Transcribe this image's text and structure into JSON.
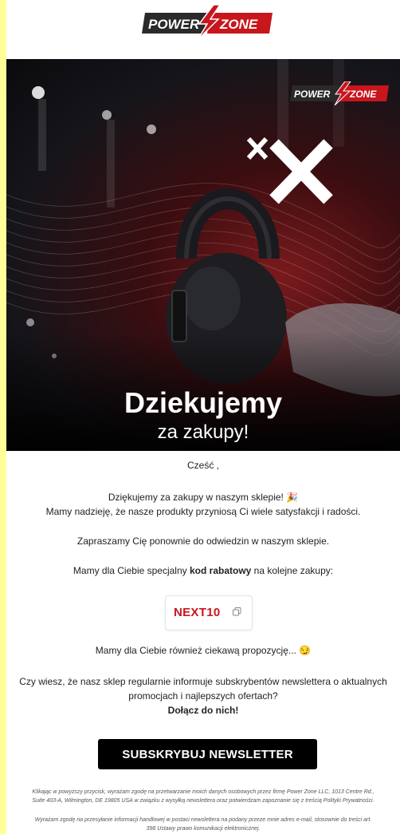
{
  "brand": {
    "part1": "POWER",
    "part2": "ZONE"
  },
  "hero": {
    "title": "Dziekujemy",
    "subtitle": "za zakupy!"
  },
  "greeting": "Cześć ,",
  "thanks_line1": "Dziękujemy za zakupy w naszym sklepie! 🎉",
  "thanks_line2": "Mamy nadzieję, że nasze produkty przyniosą Ci wiele satysfakcji i radości.",
  "invite": "Zapraszamy Cię ponownie do odwiedzin w naszym sklepie.",
  "discount": {
    "before": "Mamy dla Ciebie specjalny ",
    "bold": "kod rabatowy",
    "after": " na kolejne zakupy:"
  },
  "code": "NEXT10",
  "proposal": "Mamy dla Ciebie również ciekawą propozycję... 😏",
  "newsletter_line1": "Czy wiesz, że nasz sklep regularnie informuje subskrybentów newslettera o aktualnych",
  "newsletter_line2": "promocjach i najlepszych ofertach?",
  "join": "Dołącz do nich!",
  "button_label": "SUBSKRYBUJ NEWSLETTER",
  "consent1_line1": "Klikając w powyższy przycisk, wyrażam zgodę na przetwarzanie moich danych osobowych przez firmę Power Zone LLC, 1013 Centre Rd.,",
  "consent1_line2": "Suite 403-A, Wilmington, DE 19805 USA w związku z wysyłką newslettera oraz potwierdzam zapoznanie się z treścią Polityki Prywatności.",
  "consent2_line1": "Wyrażam zgodę na przesyłanie informacji handlowej w postaci newslettera na podany przeze mnie adres e-mail, stosownie do treści art.",
  "consent2_line2": "398 Ustawy prawo komunikacji elektronicznej.",
  "colors": {
    "brand_red": "#c8161d",
    "sidebar": "#ffff9a",
    "button": "#000000"
  },
  "icons": [
    "lightning-bolt-icon",
    "copy-icon",
    "x-mark-icon",
    "party-popper-emoji",
    "smirk-emoji"
  ]
}
